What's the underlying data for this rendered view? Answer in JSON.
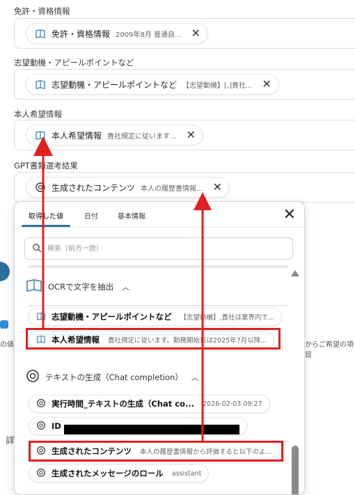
{
  "fields": [
    {
      "label": "免許・資格情報",
      "chip_title": "免許・資格情報",
      "chip_value": "2009年8月 普通自..."
    },
    {
      "label": "志望動機・アピールポイントなど",
      "chip_title": "志望動機・アピールポイントなど",
      "chip_value": "【志望動機】[,]貴社..."
    },
    {
      "label": "本人希望情報",
      "chip_title": "本人希望情報",
      "chip_value": "貴社規定に従います..."
    },
    {
      "label": "GPT書類選考結果",
      "chip_title": "生成されたコンテンツ",
      "chip_value": "本人の履歴書情報..."
    }
  ],
  "background": {
    "partial_a": "の値",
    "partial_b": "からご希望の項目",
    "partial_c": "詳"
  },
  "popup": {
    "tabs": [
      "取得した値",
      "日付",
      "基本情報"
    ],
    "active_tab": 0,
    "search_placeholder": "検索（前方一致）",
    "section_ocr": "OCRで文字を抽出",
    "ocr_items": [
      {
        "title": "志望動機・アピールポイントなど",
        "value": "【志望動機】,貴社は業界内で..."
      },
      {
        "title": "本人希望情報",
        "value": "貴社規定に従います。勤務開始日は2025年7月以降..."
      }
    ],
    "section_gpt": "テキストの生成（Chat completion）",
    "gpt_items": [
      {
        "title": "実行時間_テキストの生成（Chat co...",
        "value": "2026-02-03 09:27"
      },
      {
        "title": "ID",
        "value": ""
      },
      {
        "title": "生成されたコンテンツ",
        "value": "本人の履歴書情報から評価すると以下のよ..."
      },
      {
        "title": "生成されたメッセージのロール",
        "value": "assistant"
      }
    ]
  },
  "colors": {
    "highlight": "#e0201e",
    "accent": "#2e6f9e"
  }
}
